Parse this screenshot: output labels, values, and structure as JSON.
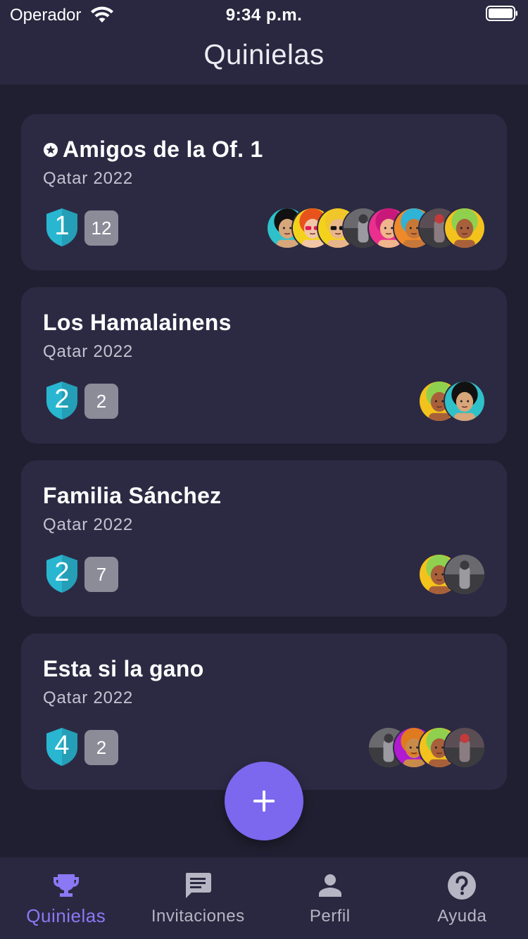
{
  "status_bar": {
    "carrier": "Operador",
    "time": "9:34 p.m."
  },
  "header": {
    "title": "Quinielas"
  },
  "accent_color": "#7b68ee",
  "rank_color": "#29b6d1",
  "quinielas": [
    {
      "name": "Amigos de la Of. 1",
      "starred": true,
      "tournament": "Qatar 2022",
      "rank": "1",
      "participants": "12",
      "avatars": [
        "avatar-afro-teal",
        "avatar-redhair-sunglasses",
        "avatar-blond-sunglasses",
        "avatar-photo-figure",
        "avatar-pink-hair",
        "avatar-orange-mohawk",
        "avatar-photo-person",
        "avatar-green-hair"
      ]
    },
    {
      "name": "Los Hamalainens",
      "starred": false,
      "tournament": "Qatar 2022",
      "rank": "2",
      "participants": "2",
      "avatars": [
        "avatar-green-hair",
        "avatar-afro-teal"
      ]
    },
    {
      "name": "Familia Sánchez",
      "starred": false,
      "tournament": "Qatar 2022",
      "rank": "2",
      "participants": "7",
      "avatars": [
        "avatar-green-hair",
        "avatar-photo-figure"
      ]
    },
    {
      "name": "Esta si la gano",
      "starred": false,
      "tournament": "Qatar 2022",
      "rank": "4",
      "participants": "2",
      "avatars": [
        "avatar-photo-figure",
        "avatar-orange-beard",
        "avatar-green-hair",
        "avatar-photo-person"
      ]
    }
  ],
  "fab": {
    "icon": "plus-icon"
  },
  "nav": {
    "items": [
      {
        "label": "Quinielas",
        "icon": "trophy-icon",
        "active": true
      },
      {
        "label": "Invitaciones",
        "icon": "message-icon",
        "active": false
      },
      {
        "label": "Perfil",
        "icon": "person-icon",
        "active": false
      },
      {
        "label": "Ayuda",
        "icon": "help-icon",
        "active": false
      }
    ]
  }
}
